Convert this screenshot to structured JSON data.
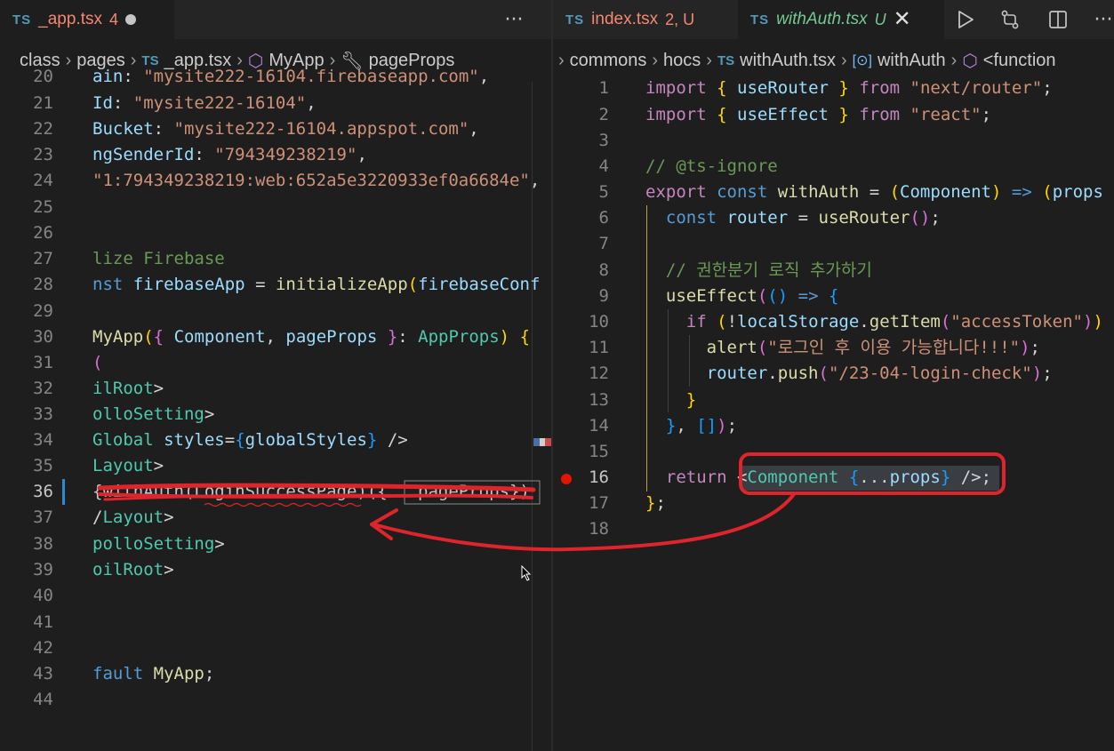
{
  "left_editor": {
    "tab": {
      "lang": "TS",
      "filename": "_app.tsx",
      "problems": "4"
    },
    "more_actions": "···",
    "breadcrumb": [
      "class",
      "pages",
      "_app.tsx",
      "MyApp",
      "pageProps"
    ],
    "lines": [
      {
        "n": "20",
        "text": "ain: \"mysite222-16104.firebaseapp.com\","
      },
      {
        "n": "21",
        "text": "Id: \"mysite222-16104\","
      },
      {
        "n": "22",
        "text": "Bucket: \"mysite222-16104.appspot.com\","
      },
      {
        "n": "23",
        "text": "ngSenderId: \"794349238219\","
      },
      {
        "n": "24",
        "text": "\"1:794349238219:web:652a5e3220933ef0a6684e\","
      },
      {
        "n": "25",
        "text": ""
      },
      {
        "n": "26",
        "text": ""
      },
      {
        "n": "27",
        "text": "lize Firebase"
      },
      {
        "n": "28",
        "text": "nst firebaseApp = initializeApp(firebaseConf"
      },
      {
        "n": "29",
        "text": ""
      },
      {
        "n": "30",
        "text": "MyApp({ Component, pageProps }: AppProps) {"
      },
      {
        "n": "31",
        "text": "("
      },
      {
        "n": "32",
        "text": "ilRoot>"
      },
      {
        "n": "33",
        "text": "olloSetting>"
      },
      {
        "n": "34",
        "text": "Global styles={globalStyles} />"
      },
      {
        "n": "35",
        "text": "Layout>"
      },
      {
        "n": "36",
        "text": "{withAuth(LoginSuccessPage)({...pageProps})"
      },
      {
        "n": "37",
        "text": "/Layout>"
      },
      {
        "n": "38",
        "text": "polloSetting>"
      },
      {
        "n": "39",
        "text": "oilRoot>"
      },
      {
        "n": "40",
        "text": ""
      },
      {
        "n": "41",
        "text": ""
      },
      {
        "n": "42",
        "text": ""
      },
      {
        "n": "43",
        "text": "fault MyApp;"
      },
      {
        "n": "44",
        "text": ""
      }
    ]
  },
  "right_editor": {
    "tabs": [
      {
        "lang": "TS",
        "filename": "index.tsx",
        "badge": "2, U",
        "active": false
      },
      {
        "lang": "TS",
        "filename": "withAuth.tsx",
        "badge": "U",
        "active": true
      }
    ],
    "actions": [
      "run-icon",
      "compare-changes-icon",
      "split-editor-icon",
      "more-actions-icon"
    ],
    "breadcrumb": [
      "commons",
      "hocs",
      "withAuth.tsx",
      "withAuth",
      "<function"
    ],
    "lines": [
      {
        "n": "1",
        "text": "import { useRouter } from \"next/router\";"
      },
      {
        "n": "2",
        "text": "import { useEffect } from \"react\";"
      },
      {
        "n": "3",
        "text": ""
      },
      {
        "n": "4",
        "text": "// @ts-ignore"
      },
      {
        "n": "5",
        "text": "export const withAuth = (Component) => (props"
      },
      {
        "n": "6",
        "text": "  const router = useRouter();"
      },
      {
        "n": "7",
        "text": ""
      },
      {
        "n": "8",
        "text": "  // 권한분기 로직 추가하기"
      },
      {
        "n": "9",
        "text": "  useEffect(() => {"
      },
      {
        "n": "10",
        "text": "    if (!localStorage.getItem(\"accessToken\"))"
      },
      {
        "n": "11",
        "text": "      alert(\"로그인 후 이용 가능합니다!!!\");"
      },
      {
        "n": "12",
        "text": "      router.push(\"/23-04-login-check\");"
      },
      {
        "n": "13",
        "text": "    }"
      },
      {
        "n": "14",
        "text": "  }, []);"
      },
      {
        "n": "15",
        "text": ""
      },
      {
        "n": "16",
        "text": "  return <Component {...props} />;"
      },
      {
        "n": "17",
        "text": "};"
      },
      {
        "n": "18",
        "text": ""
      }
    ]
  },
  "colors": {
    "editor_bg": "#1e1e1e",
    "tabbar_bg": "#252526",
    "annotation_red": "#e0242c",
    "breakpoint": "#e51400"
  }
}
